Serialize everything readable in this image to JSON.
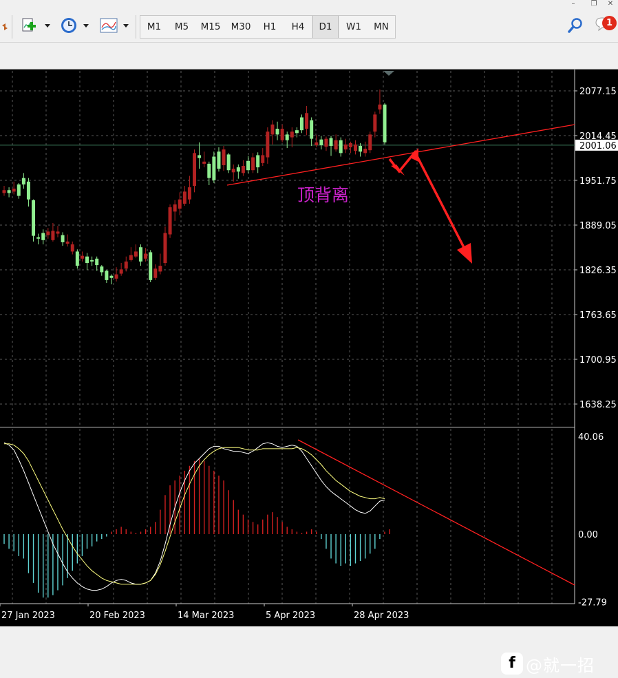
{
  "window_controls": {
    "minimize": "–",
    "restore": "❐",
    "close": "✕"
  },
  "toolbar": {
    "timeframes": [
      "M1",
      "M5",
      "M15",
      "M30",
      "H1",
      "H4",
      "D1",
      "W1",
      "MN"
    ],
    "active_timeframe": "D1",
    "notification_count": "1",
    "icons": [
      "new-chart-icon",
      "clock-icon",
      "indicators-icon",
      "search-icon",
      "chat-icon"
    ]
  },
  "colors": {
    "background": "#000000",
    "bull_candle": "#90ee90",
    "bear_candle": "#b22222",
    "grid": "#5a5a5a",
    "signal_line": "#ffff80",
    "macd_line": "#ffffff",
    "hist_positive": "#d22020",
    "hist_negative": "#5fd3d3",
    "annotation": "#ff2020",
    "annotation_text": "#cc22cc"
  },
  "annotation": {
    "label": "顶背离"
  },
  "watermark": {
    "icon": "f",
    "text": "@就一招"
  },
  "chart_data": [
    {
      "type": "candlestick",
      "price_axis": {
        "ticks": [
          "2077.15",
          "2014.45",
          "1951.75",
          "1889.05",
          "1826.35",
          "1763.65",
          "1700.95",
          "1638.25"
        ],
        "current_price": "2001.06",
        "ylim": [
          1605,
          2110
        ]
      },
      "time_axis": {
        "labels": [
          "27 Jan 2023",
          "20 Feb 2023",
          "14 Mar 2023",
          "5 Apr 2023",
          "28 Apr 2023"
        ]
      },
      "candles": [
        [
          1938,
          1944,
          1930,
          1934
        ],
        [
          1934,
          1942,
          1928,
          1938
        ],
        [
          1940,
          1950,
          1932,
          1936
        ],
        [
          1930,
          1948,
          1926,
          1946
        ],
        [
          1946,
          1962,
          1940,
          1955
        ],
        [
          1925,
          1955,
          1915,
          1950
        ],
        [
          1874,
          1925,
          1866,
          1924
        ],
        [
          1870,
          1877,
          1862,
          1872
        ],
        [
          1868,
          1883,
          1862,
          1878
        ],
        [
          1880,
          1885,
          1870,
          1875
        ],
        [
          1881,
          1892,
          1866,
          1868
        ],
        [
          1880,
          1888,
          1872,
          1877
        ],
        [
          1865,
          1879,
          1860,
          1875
        ],
        [
          1866,
          1876,
          1859,
          1863
        ],
        [
          1862,
          1866,
          1848,
          1852
        ],
        [
          1832,
          1855,
          1828,
          1852
        ],
        [
          1846,
          1852,
          1838,
          1842
        ],
        [
          1836,
          1850,
          1826,
          1845
        ],
        [
          1838,
          1845,
          1832,
          1840
        ],
        [
          1833,
          1845,
          1825,
          1842
        ],
        [
          1823,
          1833,
          1818,
          1831
        ],
        [
          1812,
          1826,
          1808,
          1825
        ],
        [
          1815,
          1820,
          1806,
          1818
        ],
        [
          1820,
          1830,
          1810,
          1814
        ],
        [
          1827,
          1836,
          1818,
          1821
        ],
        [
          1838,
          1845,
          1824,
          1828
        ],
        [
          1847,
          1858,
          1838,
          1840
        ],
        [
          1852,
          1862,
          1843,
          1845
        ],
        [
          1838,
          1862,
          1832,
          1858
        ],
        [
          1849,
          1857,
          1838,
          1842
        ],
        [
          1812,
          1854,
          1809,
          1851
        ],
        [
          1828,
          1834,
          1812,
          1815
        ],
        [
          1832,
          1849,
          1820,
          1824
        ],
        [
          1878,
          1887,
          1832,
          1836
        ],
        [
          1914,
          1918,
          1871,
          1876
        ],
        [
          1918,
          1924,
          1895,
          1908
        ],
        [
          1925,
          1935,
          1903,
          1912
        ],
        [
          1936,
          1944,
          1916,
          1919
        ],
        [
          1942,
          1958,
          1919,
          1925
        ],
        [
          1990,
          1995,
          1935,
          1944
        ],
        [
          1983,
          2005,
          1968,
          1987
        ],
        [
          1978,
          1992,
          1970,
          1975
        ],
        [
          1955,
          1978,
          1945,
          1975
        ],
        [
          1952,
          1992,
          1948,
          1985
        ],
        [
          1968,
          1998,
          1964,
          1992
        ],
        [
          1995,
          2000,
          1965,
          1973
        ],
        [
          1966,
          1990,
          1962,
          1988
        ],
        [
          1968,
          1974,
          1950,
          1963
        ],
        [
          1964,
          1974,
          1954,
          1970
        ],
        [
          1972,
          1980,
          1958,
          1962
        ],
        [
          1966,
          1986,
          1962,
          1979
        ],
        [
          1984,
          1990,
          1962,
          1966
        ],
        [
          1970,
          1991,
          1962,
          1987
        ],
        [
          1987,
          1997,
          1972,
          1976
        ],
        [
          2020,
          2026,
          1975,
          1984
        ],
        [
          2030,
          2036,
          2002,
          2016
        ],
        [
          2016,
          2034,
          2008,
          2024
        ],
        [
          2024,
          2030,
          2005,
          2008
        ],
        [
          2008,
          2020,
          1997,
          2016
        ],
        [
          2020,
          2026,
          1998,
          2012
        ],
        [
          2018,
          2026,
          2012,
          2022
        ],
        [
          2022,
          2044,
          2018,
          2040
        ],
        [
          2046,
          2056,
          2015,
          2024
        ],
        [
          2010,
          2040,
          2000,
          2036
        ],
        [
          2005,
          2015,
          1998,
          2001
        ],
        [
          2001,
          2014,
          1995,
          2009
        ],
        [
          2010,
          2013,
          1993,
          1999
        ],
        [
          2000,
          2014,
          1986,
          2011
        ],
        [
          2008,
          2016,
          1992,
          1995
        ],
        [
          1990,
          2012,
          1985,
          2008
        ],
        [
          2002,
          2010,
          1990,
          1995
        ],
        [
          2004,
          2006,
          1990,
          1998
        ],
        [
          2002,
          2008,
          1988,
          1993
        ],
        [
          1992,
          2004,
          1985,
          2000
        ],
        [
          1996,
          2006,
          1985,
          1990
        ],
        [
          2016,
          2020,
          1990,
          1994
        ],
        [
          2044,
          2048,
          2012,
          2020
        ],
        [
          2058,
          2079,
          2045,
          2051
        ],
        [
          2005,
          2060,
          2002,
          2058
        ]
      ]
    },
    {
      "type": "macd",
      "axis": {
        "ticks": [
          "40.06",
          "0.00",
          "-27.79"
        ],
        "ylim": [
          -27.79,
          40.06
        ]
      },
      "histogram": [
        -4,
        -6,
        -7,
        -9,
        -10,
        -16,
        -20,
        -24,
        -26,
        -26,
        -25,
        -23,
        -21,
        -18,
        -15,
        -12,
        -9,
        -6,
        -5,
        -3,
        -2,
        -1,
        1,
        2,
        3,
        2,
        1,
        0.5,
        1,
        2,
        3,
        5,
        10,
        16,
        20,
        22,
        24,
        26,
        28,
        30,
        31,
        30,
        28,
        26,
        24,
        22,
        18,
        14,
        10,
        8,
        6,
        5,
        4,
        6,
        8,
        9,
        7,
        5,
        3,
        2,
        1,
        0.5,
        1,
        2,
        1,
        -2,
        -6,
        -10,
        -12,
        -13,
        -12,
        -13,
        -12,
        -11,
        -10,
        -8,
        -6,
        -2,
        1,
        2
      ],
      "macd_line": [
        37.5,
        36.5,
        34.5,
        30.5,
        26,
        21,
        16,
        11,
        6,
        1,
        -4,
        -8,
        -12,
        -15.5,
        -18,
        -20,
        -21.5,
        -22.5,
        -23,
        -23,
        -22.5,
        -21.5,
        -20,
        -19,
        -18.5,
        -19,
        -20,
        -20.5,
        -20.5,
        -20,
        -19,
        -16,
        -11,
        -4,
        4,
        11,
        17,
        22,
        26,
        29,
        31,
        33,
        35,
        36,
        36,
        35,
        34.5,
        34,
        34,
        33.5,
        33,
        34,
        35.5,
        37,
        37.5,
        37,
        36,
        35.5,
        36,
        36.5,
        36,
        34,
        31,
        28,
        25,
        22,
        19.5,
        17.5,
        16,
        14.5,
        13,
        11.5,
        10,
        9,
        8.5,
        9.5,
        11.5,
        13.5,
        14
      ],
      "signal_line": [
        37,
        37,
        36.5,
        35,
        33,
        30,
        26,
        22,
        18,
        14,
        10,
        6,
        2,
        -1.5,
        -5,
        -8,
        -10.5,
        -13,
        -15,
        -16.5,
        -18,
        -19,
        -19.5,
        -20,
        -20.5,
        -20.5,
        -20.5,
        -20.5,
        -20.5,
        -20,
        -19,
        -16.5,
        -12.5,
        -7,
        -1,
        5,
        10.5,
        16,
        20.5,
        24.5,
        28,
        30.5,
        32.5,
        34,
        35,
        35.5,
        35.5,
        35.5,
        35.5,
        35,
        34.5,
        34.5,
        34.5,
        35,
        35,
        35,
        35,
        35,
        35,
        35,
        35.5,
        35,
        34,
        32.5,
        30.5,
        28.5,
        26,
        24,
        22,
        20.5,
        19,
        17.5,
        16.5,
        15.5,
        15,
        14.5,
        14.5,
        15,
        14.5
      ]
    }
  ]
}
